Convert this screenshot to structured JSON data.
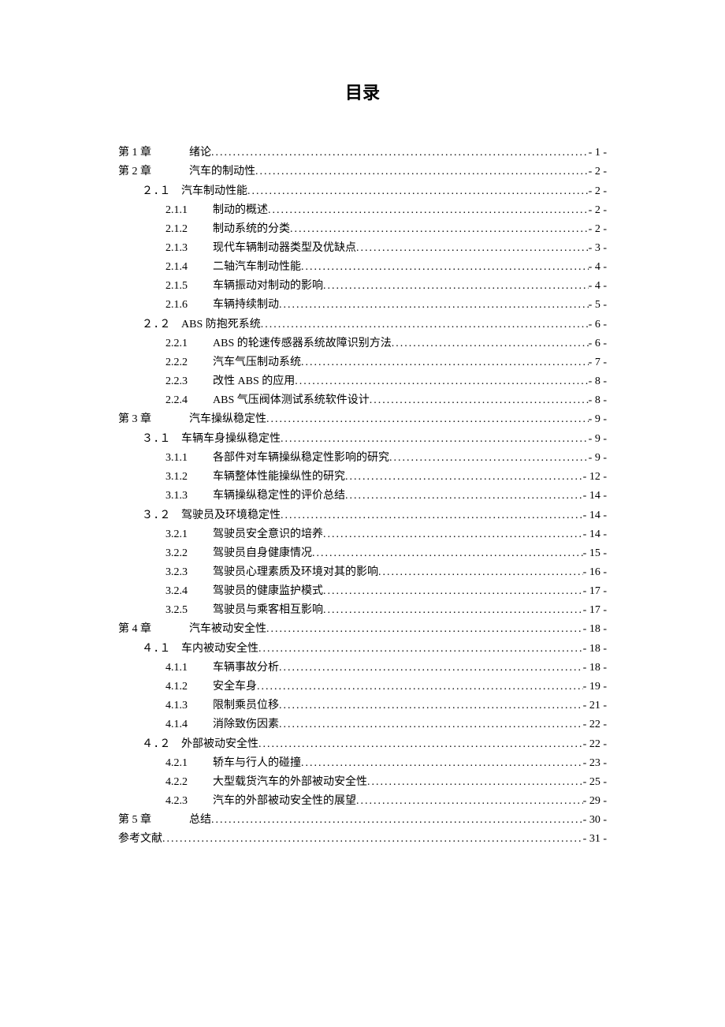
{
  "title": "目录",
  "entries": [
    {
      "level": 0,
      "label": "第 1 章",
      "title": "绪论",
      "page": "- 1 -"
    },
    {
      "level": 0,
      "label": "第 2 章",
      "title": "汽车的制动性",
      "page": "- 2 -"
    },
    {
      "level": 1,
      "label": "２.１",
      "title": "汽车制动性能",
      "page": "- 2 -"
    },
    {
      "level": 2,
      "label": "2.1.1",
      "title": "制动的概述",
      "page": "- 2 -"
    },
    {
      "level": 2,
      "label": "2.1.2",
      "title": "制动系统的分类",
      "page": "- 2 -"
    },
    {
      "level": 2,
      "label": "2.1.3",
      "title": "现代车辆制动器类型及优缺点",
      "page": "- 3 -"
    },
    {
      "level": 2,
      "label": "2.1.4",
      "title": "二轴汽车制动性能",
      "page": "- 4 -"
    },
    {
      "level": 2,
      "label": "2.1.5",
      "title": "车辆振动对制动的影响",
      "page": "- 4 -"
    },
    {
      "level": 2,
      "label": "2.1.6",
      "title": "车辆持续制动",
      "page": "- 5 -"
    },
    {
      "level": 1,
      "label": "２.２",
      "title": "ABS 防抱死系统",
      "page": "- 6 -"
    },
    {
      "level": 2,
      "label": "2.2.1",
      "title": "ABS 的轮速传感器系统故障识别方法",
      "page": "- 6 -"
    },
    {
      "level": 2,
      "label": "2.2.2",
      "title": "汽车气压制动系统",
      "page": "- 7 -"
    },
    {
      "level": 2,
      "label": "2.2.3",
      "title": "改性 ABS 的应用",
      "page": "- 8 -"
    },
    {
      "level": 2,
      "label": "2.2.4",
      "title": "ABS 气压阀体测试系统软件设计",
      "page": "- 8 -"
    },
    {
      "level": 0,
      "label": "第 3 章",
      "title": "汽车操纵稳定性",
      "page": "- 9 -"
    },
    {
      "level": 1,
      "label": "３.１",
      "title": "车辆车身操纵稳定性",
      "page": "- 9 -"
    },
    {
      "level": 2,
      "label": "3.1.1",
      "title": "各部件对车辆操纵稳定性影响的研究",
      "page": "- 9 -"
    },
    {
      "level": 2,
      "label": "3.1.2",
      "title": "车辆整体性能操纵性的研究",
      "page": "- 12 -"
    },
    {
      "level": 2,
      "label": "3.1.3",
      "title": "车辆操纵稳定性的评价总结",
      "page": "- 14 -"
    },
    {
      "level": 1,
      "label": "３.２",
      "title": "驾驶员及环境稳定性",
      "page": "- 14 -"
    },
    {
      "level": 2,
      "label": "3.2.1",
      "title": "驾驶员安全意识的培养",
      "page": "- 14 -"
    },
    {
      "level": 2,
      "label": "3.2.2",
      "title": "驾驶员自身健康情况",
      "page": "- 15 -"
    },
    {
      "level": 2,
      "label": "3.2.3",
      "title": "驾驶员心理素质及环境对其的影响",
      "page": "- 16 -"
    },
    {
      "level": 2,
      "label": "3.2.4",
      "title": "驾驶员的健康监护模式",
      "page": "- 17 -"
    },
    {
      "level": 2,
      "label": "3.2.5",
      "title": "驾驶员与乘客相互影响",
      "page": "- 17 -"
    },
    {
      "level": 0,
      "label": "第 4 章",
      "title": "汽车被动安全性",
      "page": "- 18 -"
    },
    {
      "level": 1,
      "label": "４.１",
      "title": "车内被动安全性",
      "page": "- 18 -"
    },
    {
      "level": 2,
      "label": "4.1.1",
      "title": "车辆事故分析",
      "page": "- 18 -"
    },
    {
      "level": 2,
      "label": "4.1.2",
      "title": "安全车身",
      "page": "- 19 -"
    },
    {
      "level": 2,
      "label": "4.1.3",
      "title": "限制乘员位移",
      "page": "- 21 -"
    },
    {
      "level": 2,
      "label": "4.1.4",
      "title": "消除致伤因素",
      "page": "- 22 -"
    },
    {
      "level": 1,
      "label": "４.２",
      "title": "外部被动安全性",
      "page": "- 22 -"
    },
    {
      "level": 2,
      "label": "4.2.1",
      "title": "轿车与行人的碰撞",
      "page": "- 23 -"
    },
    {
      "level": 2,
      "label": "4.2.2",
      "title": "大型载货汽车的外部被动安全性",
      "page": "- 25 -"
    },
    {
      "level": 2,
      "label": "4.2.3",
      "title": "汽车的外部被动安全性的展望",
      "page": "- 29 -"
    },
    {
      "level": 0,
      "label": "第 5 章",
      "title": "总结",
      "page": "- 30 -"
    },
    {
      "level": -1,
      "label": "",
      "title": "参考文献",
      "page": "- 31 -"
    }
  ]
}
